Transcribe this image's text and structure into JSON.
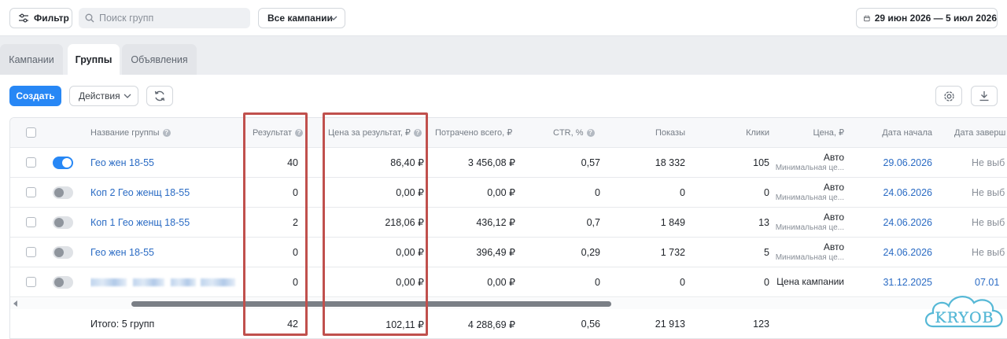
{
  "toolbar": {
    "filter_label": "Фильтр",
    "search_placeholder": "Поиск групп",
    "campaigns_label": "Все кампании",
    "date_range": "29 июн 2026 — 5 июл 2026"
  },
  "tabs": [
    {
      "label": "Кампании",
      "active": false
    },
    {
      "label": "Группы",
      "active": true
    },
    {
      "label": "Объявления",
      "active": false
    }
  ],
  "actions": {
    "create_label": "Создать",
    "actions_label": "Действия"
  },
  "table": {
    "columns": {
      "name": "Название группы",
      "result": "Результат",
      "price_per_result": "Цена за результат, ₽",
      "spent": "Потрачено всего, ₽",
      "ctr": "CTR, %",
      "shows": "Показы",
      "clicks": "Клики",
      "price": "Цена, ₽",
      "start_date": "Дата начала",
      "end_date": "Дата заверш"
    },
    "rows": [
      {
        "enabled": true,
        "name": "Гео жен 18-55",
        "result": "40",
        "price_per_result": "86,40 ₽",
        "spent": "3 456,08 ₽",
        "ctr": "0,57",
        "shows": "18 332",
        "clicks": "105",
        "price_main": "Авто",
        "price_sub": "Минимальная це...",
        "start_date": "29.06.2026",
        "end_date": "Не выб"
      },
      {
        "enabled": false,
        "name": "Коп 2 Гео женщ 18-55",
        "result": "0",
        "price_per_result": "0,00 ₽",
        "spent": "0,00 ₽",
        "ctr": "0",
        "shows": "0",
        "clicks": "0",
        "price_main": "Авто",
        "price_sub": "Минимальная це...",
        "start_date": "24.06.2026",
        "end_date": "Не выб"
      },
      {
        "enabled": false,
        "name": "Коп 1 Гео женщ 18-55",
        "result": "2",
        "price_per_result": "218,06 ₽",
        "spent": "436,12 ₽",
        "ctr": "0,7",
        "shows": "1 849",
        "clicks": "13",
        "price_main": "Авто",
        "price_sub": "Минимальная це...",
        "start_date": "24.06.2026",
        "end_date": "Не выб"
      },
      {
        "enabled": false,
        "name": "Гео жен 18-55",
        "result": "0",
        "price_per_result": "0,00 ₽",
        "spent": "396,49 ₽",
        "ctr": "0,29",
        "shows": "1 732",
        "clicks": "5",
        "price_main": "Авто",
        "price_sub": "Минимальная це...",
        "start_date": "24.06.2026",
        "end_date": "Не выб"
      },
      {
        "enabled": false,
        "name": "",
        "result": "0",
        "price_per_result": "0,00 ₽",
        "spent": "0,00 ₽",
        "ctr": "0",
        "shows": "0",
        "clicks": "0",
        "price_main": "Цена кампании",
        "price_sub": "",
        "start_date": "31.12.2025",
        "end_date": "07.01"
      }
    ],
    "total": {
      "label": "Итого: 5 групп",
      "result": "42",
      "price_per_result": "102,11 ₽",
      "spent": "4 288,69 ₽",
      "ctr": "0,56",
      "shows": "21 913",
      "clicks": "123"
    }
  },
  "watermark": {
    "text": "KRYOB"
  },
  "colors": {
    "accent": "#2787f5",
    "link": "#2a6bc4",
    "highlight": "#c0504d"
  },
  "icons": [
    "filter-icon",
    "search-icon",
    "chevron-down-icon",
    "calendar-icon",
    "refresh-icon",
    "gear-icon",
    "download-icon",
    "help-icon"
  ]
}
